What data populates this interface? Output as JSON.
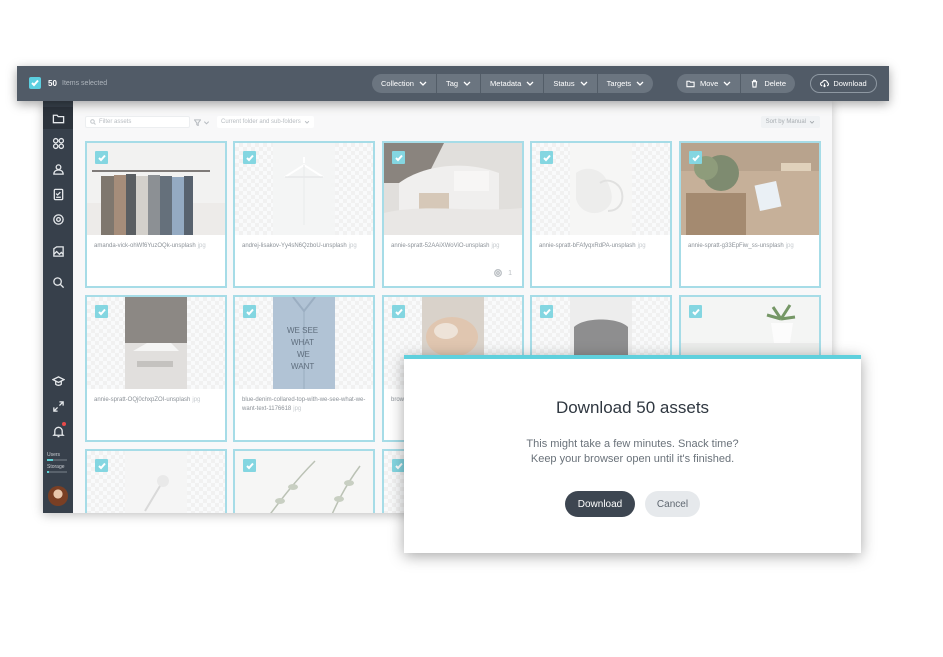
{
  "toolbar": {
    "selected_count": "50",
    "selected_label": "Items selected",
    "filters": [
      {
        "label": "Collection"
      },
      {
        "label": "Tag"
      },
      {
        "label": "Metadata"
      },
      {
        "label": "Status"
      },
      {
        "label": "Targets"
      }
    ],
    "actions": [
      {
        "label": "Move"
      },
      {
        "label": "Delete"
      }
    ],
    "download_label": "Download"
  },
  "filterbar": {
    "search_placeholder": "Filter assets",
    "scope_label": "Current folder and sub-folders",
    "sort_label": "Sort by Manual"
  },
  "sidebar": {
    "icons": [
      "folder-icon",
      "collections-icon",
      "people-icon",
      "tasks-icon",
      "settings-icon",
      "gallery-icon",
      "search-icon",
      "academy-icon",
      "expand-icon",
      "bell-icon"
    ],
    "users_label": "Users",
    "storage_label": "Storage",
    "users_usage": 0.3,
    "storage_usage": 0.12
  },
  "assets": [
    {
      "name": "amanda-vick-ohWf6YuzOQk-unsplash",
      "ext": "jpg",
      "selected": true
    },
    {
      "name": "andrej-lisakov-Yy4sN6QzboU-unsplash",
      "ext": "jpg",
      "selected": true
    },
    {
      "name": "annie-spratt-52AAiXWoViO-unsplash",
      "ext": "jpg",
      "selected": true,
      "count": "1"
    },
    {
      "name": "annie-spratt-bFAfyqxRdPA-unsplash",
      "ext": "jpg",
      "selected": true
    },
    {
      "name": "annie-spratt-g33EpFiw_ss-unsplash",
      "ext": "jpg",
      "selected": true
    },
    {
      "name": "annie-spratt-OQj0chxpZOI-unsplash",
      "ext": "jpg",
      "selected": true
    },
    {
      "name": "blue-denim-collared-top-with-we-see-what-we-want-text-1176618",
      "ext": "jpg",
      "selected": true
    },
    {
      "name": "brown-...-text",
      "ext": "",
      "selected": true
    },
    {
      "name": "",
      "ext": "",
      "selected": true
    },
    {
      "name": "",
      "ext": "",
      "selected": true
    },
    {
      "name": "",
      "ext": "",
      "selected": true
    },
    {
      "name": "",
      "ext": "",
      "selected": true
    },
    {
      "name": "",
      "ext": "",
      "selected": true
    }
  ],
  "modal": {
    "title": "Download 50 assets",
    "line1": "This might take a few minutes. Snack time?",
    "line2": "Keep your browser open until it's finished.",
    "primary": "Download",
    "secondary": "Cancel"
  },
  "colors": {
    "accent": "#5fd0dd",
    "toolbar": "#515b67",
    "sidebar": "#37404b",
    "primary_button": "#3d4651"
  }
}
